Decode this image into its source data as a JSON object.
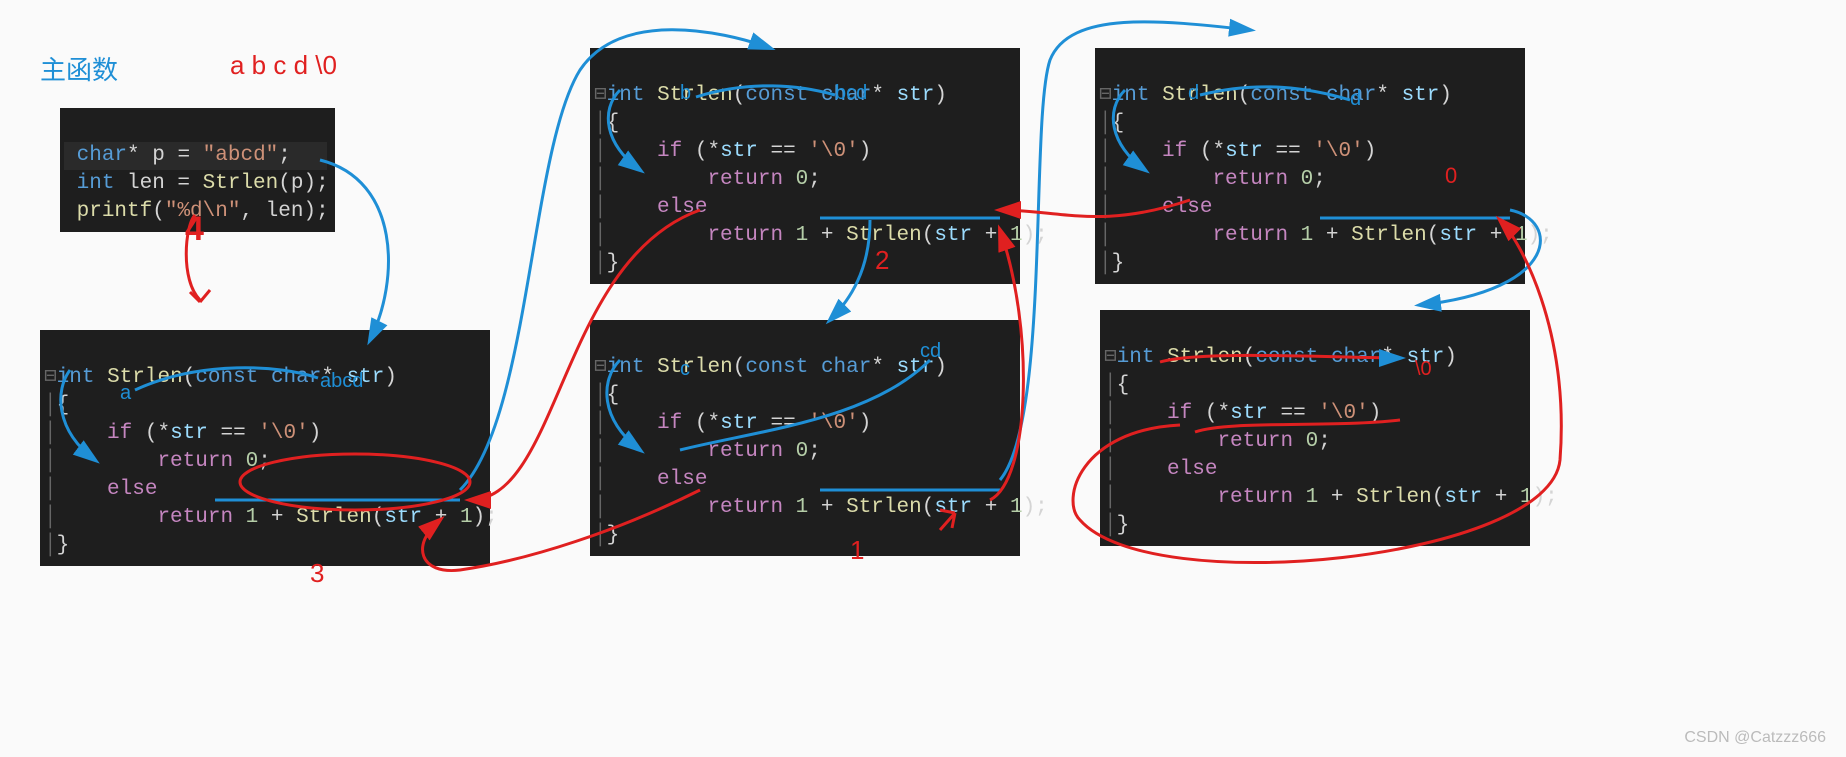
{
  "header": {
    "title": "主函数",
    "string_note": "a b c d \\0"
  },
  "main_code": {
    "l1": "char* p = \"abcd\";",
    "l2": "int len = Strlen(p);",
    "l3": "printf(\"%d\\n\", len);"
  },
  "strlen_func": {
    "sig": "int Strlen(const char* str)",
    "body": "{\n    if (*str == '\\0')\n        return 0;\n    else\n        return 1 + Strlen(str + 1);\n}"
  },
  "annotations": {
    "char_a": "a",
    "char_b": "b",
    "char_c": "c",
    "char_d": "d",
    "str_abcd": "abcd",
    "str_bcd": "bcd",
    "str_cd": "cd",
    "str_d": "d",
    "nul": "\\0",
    "zero": "0",
    "n1": "1",
    "n2": "2",
    "n3": "3",
    "result": "4"
  },
  "watermark": "CSDN @Catzzz666"
}
